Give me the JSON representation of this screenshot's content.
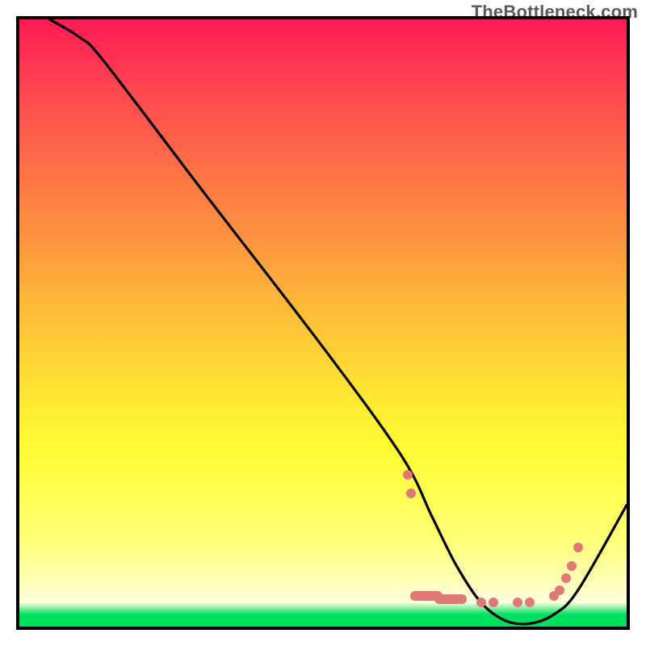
{
  "watermark": "TheBottleneck.com",
  "chart_data": {
    "type": "line",
    "title": "",
    "xlabel": "",
    "ylabel": "",
    "xlim": [
      0,
      100
    ],
    "ylim": [
      0,
      100
    ],
    "background_gradient": [
      {
        "pos": 0,
        "color": "#ff1a55"
      },
      {
        "pos": 25,
        "color": "#ff7246"
      },
      {
        "pos": 50,
        "color": "#ffc238"
      },
      {
        "pos": 70,
        "color": "#fffa33"
      },
      {
        "pos": 92,
        "color": "#ffffb0"
      },
      {
        "pos": 98,
        "color": "#00e060"
      },
      {
        "pos": 100,
        "color": "#00e060"
      }
    ],
    "series": [
      {
        "name": "bottleneck-curve",
        "color": "#000000",
        "x": [
          5,
          10,
          14,
          30,
          50,
          63,
          68,
          72,
          76,
          80,
          84,
          88,
          92,
          100
        ],
        "y": [
          100,
          97,
          93,
          72,
          46,
          28,
          18,
          10,
          4,
          1,
          0.5,
          2,
          6,
          20
        ]
      }
    ],
    "highlighted_points": {
      "name": "points-near-min",
      "color": "#e07878",
      "items": [
        {
          "x": 64,
          "y": 25
        },
        {
          "x": 64.5,
          "y": 22
        },
        {
          "x": 67,
          "y": 5,
          "long": true
        },
        {
          "x": 71,
          "y": 4.5,
          "long": true
        },
        {
          "x": 76,
          "y": 4
        },
        {
          "x": 78,
          "y": 4
        },
        {
          "x": 82,
          "y": 4
        },
        {
          "x": 84,
          "y": 4
        },
        {
          "x": 88,
          "y": 5
        },
        {
          "x": 89,
          "y": 6
        },
        {
          "x": 90,
          "y": 8
        },
        {
          "x": 91,
          "y": 10
        },
        {
          "x": 92,
          "y": 13
        }
      ]
    }
  }
}
